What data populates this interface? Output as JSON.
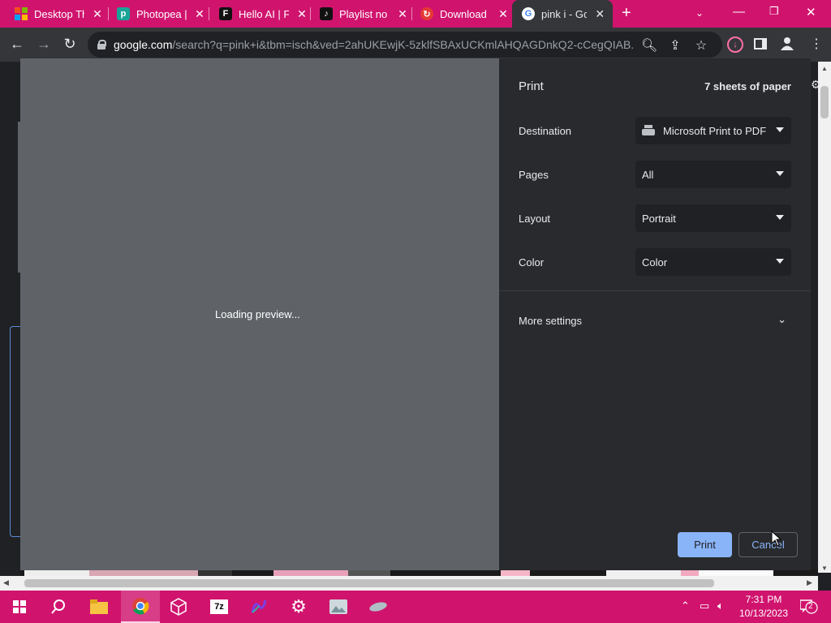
{
  "tabs": [
    {
      "title": "Desktop Th",
      "icon": "windows-icon",
      "color": "#f25022"
    },
    {
      "title": "Photopea |",
      "icon": "photopea-icon",
      "color": "#18a497"
    },
    {
      "title": "Hello AI | F",
      "icon": "framer-icon",
      "color": "#000000"
    },
    {
      "title": "Playlist no",
      "icon": "tiktok-icon",
      "color": "#000000"
    },
    {
      "title": "Download",
      "icon": "download-site-icon",
      "color": "#e53935"
    },
    {
      "title": "pink i - Goo",
      "icon": "google-icon",
      "color": "#4285f4"
    }
  ],
  "omnibox": {
    "url_host": "google.com",
    "url_path": "/search?q=pink+i&tbm=isch&ved=2ahUKEwjK-5zklfSBAxUCKmlAHQAGDnkQ2-cCegQIAB..."
  },
  "print": {
    "title": "Print",
    "sheets": "7 sheets of paper",
    "preview_text": "Loading preview...",
    "rows": [
      {
        "label": "Destination",
        "value": "Microsoft Print to PDF"
      },
      {
        "label": "Pages",
        "value": "All"
      },
      {
        "label": "Layout",
        "value": "Portrait"
      },
      {
        "label": "Color",
        "value": "Color"
      }
    ],
    "more_settings": "More settings",
    "print_button": "Print",
    "cancel_button": "Cancel"
  },
  "taskbar": {
    "time": "7:31 PM",
    "date": "10/13/2023",
    "notifications": "2",
    "apps": [
      "start-icon",
      "search-icon",
      "file-explorer-icon",
      "chrome-icon",
      "virtualbox-icon",
      "7zip-icon",
      "app-icon",
      "settings-icon",
      "image-app-icon",
      "mouse-app-icon"
    ]
  },
  "colors": {
    "accent": "#d0146e",
    "print_button": "#8ab4f8",
    "dialog_bg": "#292a2d",
    "preview_bg": "#5f6368"
  }
}
